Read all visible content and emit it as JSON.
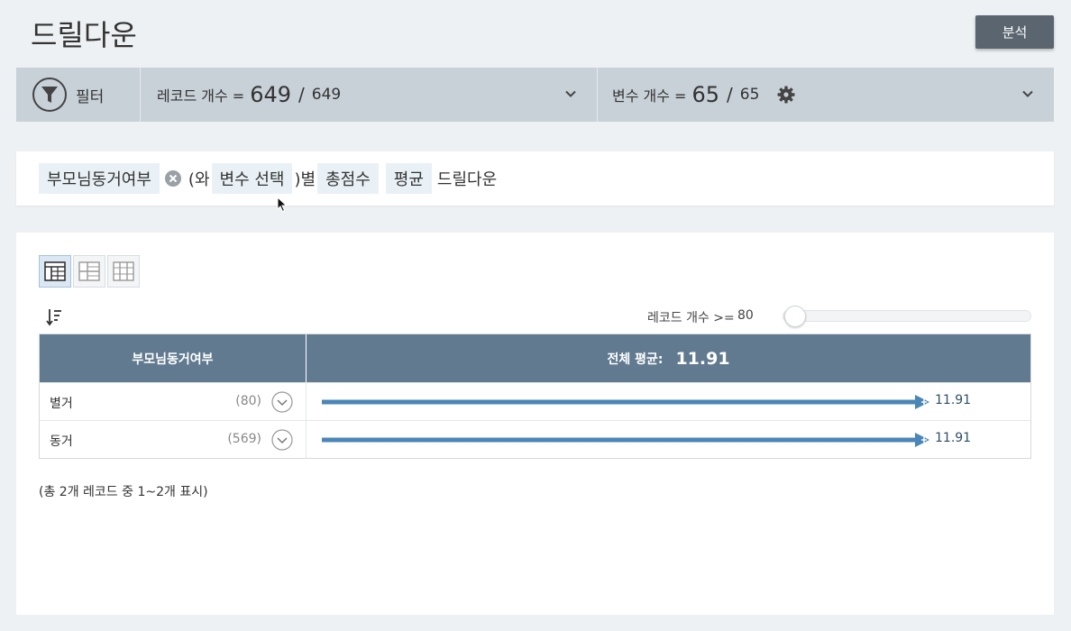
{
  "header": {
    "title": "드릴다운",
    "analyze_label": "분석"
  },
  "filter_bar": {
    "filter_label": "필터",
    "record_label": "레코드 개수 =",
    "record_selected": "649",
    "record_sep": "/",
    "record_total": "649",
    "var_label": "변수 개수 =",
    "var_selected": "65",
    "var_sep": "/",
    "var_total": "65"
  },
  "query": {
    "group_var": "부모님동거여부",
    "text_and": "(와",
    "var_select": "변수 선택",
    "text_by": ")별",
    "measure": "총점수",
    "stat": "평균",
    "suffix": "드릴다운"
  },
  "result": {
    "min_records_label": "레코드 개수 >=",
    "min_records_value": "80",
    "min_records_fraction": 0.0,
    "column_header": "부모님동거여부",
    "overall_label": "전체 평균:",
    "overall_value": "11.91",
    "rows": [
      {
        "label": "별거",
        "count": "(80)",
        "value": "11.91",
        "num": 11.91
      },
      {
        "label": "동거",
        "count": "(569)",
        "value": "11.91",
        "num": 11.91
      }
    ],
    "bar_max": 11.91,
    "summary": "(총 2개 레코드 중 1~2개 표시)"
  },
  "colors": {
    "header_bg": "#617a8f",
    "bar": "#4a86b8",
    "filter_bg": "#c8d0d8",
    "chip_bg": "#e9f1f7"
  },
  "icons": [
    "funnel-icon",
    "chevron-down-icon",
    "gear-icon",
    "remove-icon",
    "table-view-icon",
    "split-view-icon",
    "pivot-view-icon",
    "sort-icon",
    "expand-icon"
  ]
}
